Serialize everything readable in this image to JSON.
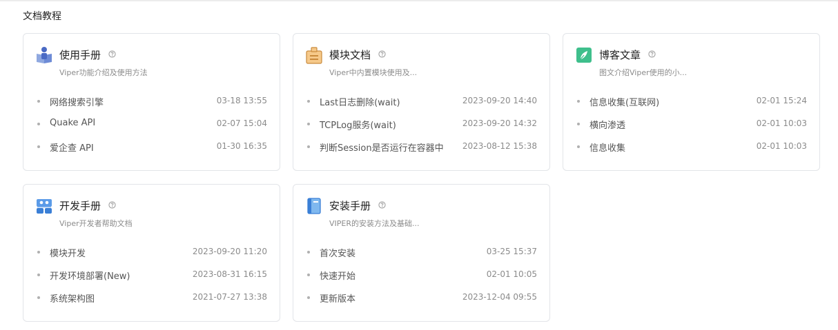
{
  "section": {
    "title": "文档教程"
  },
  "cards": [
    {
      "title": "使用手册",
      "icon": "user-manual-icon",
      "desc": "Viper功能介绍及使用方法",
      "items": [
        {
          "label": "网络搜索引擎",
          "time": "03-18 13:55"
        },
        {
          "label": "Quake API",
          "time": "02-07 15:04"
        },
        {
          "label": "爱企查 API",
          "time": "01-30 16:35"
        }
      ]
    },
    {
      "title": "模块文档",
      "icon": "module-doc-icon",
      "desc": "Viper中内置模块使用及...",
      "items": [
        {
          "label": "Last日志删除(wait)",
          "time": "2023-09-20 14:40"
        },
        {
          "label": "TCPLog服务(wait)",
          "time": "2023-09-20 14:32"
        },
        {
          "label": "判断Session是否运行在容器中",
          "time": "2023-08-12 15:38"
        }
      ]
    },
    {
      "title": "博客文章",
      "icon": "blog-article-icon",
      "desc": "图文介绍Viper使用的小...",
      "items": [
        {
          "label": "信息收集(互联网)",
          "time": "02-01 15:24"
        },
        {
          "label": "横向渗透",
          "time": "02-01 10:03"
        },
        {
          "label": "信息收集",
          "time": "02-01 10:03"
        }
      ]
    },
    {
      "title": "开发手册",
      "icon": "developer-manual-icon",
      "desc": "Viper开发者帮助文档",
      "items": [
        {
          "label": "模块开发",
          "time": "2023-09-20 11:20"
        },
        {
          "label": "开发环境部署(New)",
          "time": "2023-08-31 16:15"
        },
        {
          "label": "系统架构图",
          "time": "2021-07-27 13:38"
        }
      ]
    },
    {
      "title": "安装手册",
      "icon": "install-manual-icon",
      "desc": "VIPER的安装方法及基础...",
      "items": [
        {
          "label": "首次安装",
          "time": "03-25 15:37"
        },
        {
          "label": "快速开始",
          "time": "02-01 10:05"
        },
        {
          "label": "更新版本",
          "time": "2023-12-04 09:55"
        }
      ]
    }
  ]
}
